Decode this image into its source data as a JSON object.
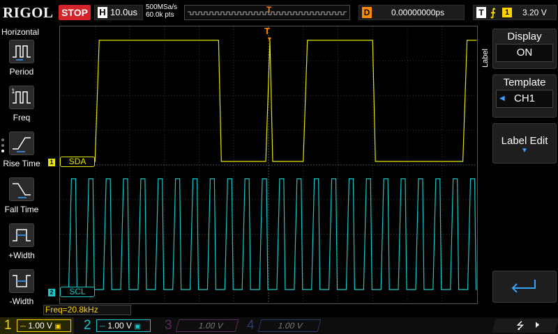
{
  "topbar": {
    "brand": "RIGOL",
    "run_state": "STOP",
    "timebase_letter": "H",
    "timebase": "10.0us",
    "sample_rate": "500MSa/s",
    "mem_depth": "60.0k pts",
    "delay_letter": "D",
    "delay": "0.00000000ps",
    "trigger_letter": "T",
    "trigger_channel": "1",
    "trigger_level": "3.20 V"
  },
  "left_menu": {
    "title": "Horizontal",
    "items": [
      {
        "label": "Period",
        "icon": "period-icon"
      },
      {
        "label": "Freq",
        "icon": "freq-icon"
      },
      {
        "label": "Rise Time",
        "icon": "rise-time-icon"
      },
      {
        "label": "Fall Time",
        "icon": "fall-time-icon"
      },
      {
        "label": "+Width",
        "icon": "pos-width-icon"
      },
      {
        "label": "-Width",
        "icon": "neg-width-icon"
      }
    ]
  },
  "right_menu": {
    "tab": "Label",
    "display_label": "Display",
    "display_value": "ON",
    "template_label": "Template",
    "template_value": "CH1",
    "label_edit": "Label Edit"
  },
  "channels": {
    "ch1_label": "SDA",
    "ch2_label": "SCL",
    "ch1_num": "1",
    "ch2_num": "2"
  },
  "measurement": {
    "freq": "Freq=20.8kHz"
  },
  "bottombar": {
    "ch1": {
      "num": "1",
      "scale": "1.00 V"
    },
    "ch2": {
      "num": "2",
      "scale": "1.00 V"
    },
    "ch3": {
      "num": "3",
      "scale": "1.00 V"
    },
    "ch4": {
      "num": "4",
      "scale": "1.00 V"
    }
  },
  "colors": {
    "ch1": "#e6e600",
    "ch2": "#19c8c8",
    "ch3": "#c040c0",
    "ch4": "#3a6ad8",
    "trigger": "#ff8a00",
    "stop": "#d4242a"
  }
}
